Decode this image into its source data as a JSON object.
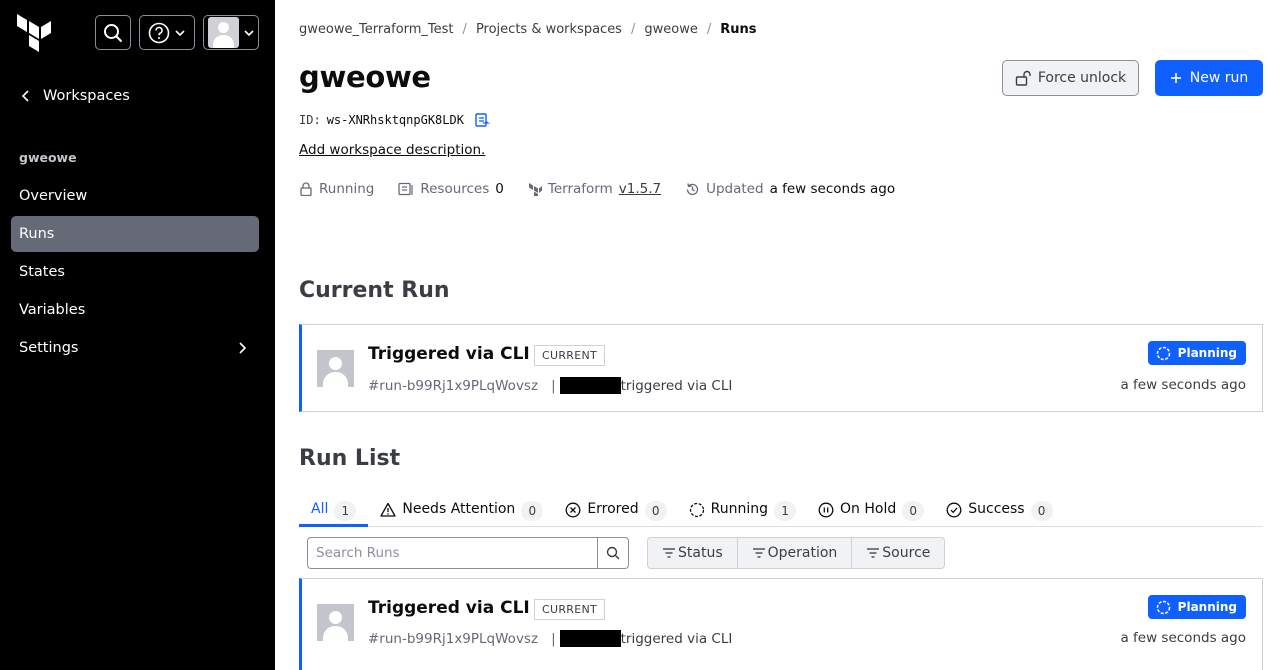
{
  "sidebar": {
    "back_label": "Workspaces",
    "workspace_name": "gweowe",
    "items": [
      {
        "label": "Overview"
      },
      {
        "label": "Runs"
      },
      {
        "label": "States"
      },
      {
        "label": "Variables"
      },
      {
        "label": "Settings"
      }
    ],
    "active_item": "Runs"
  },
  "breadcrumb": [
    "gweowe_Terraform_Test",
    "Projects & workspaces",
    "gweowe",
    "Runs"
  ],
  "header": {
    "title": "gweowe",
    "id_label": "ID:",
    "id_value": "ws-XNRhsktqnpGK8LDK",
    "add_description": "Add workspace description.",
    "force_unlock": "Force unlock",
    "new_run": "New run"
  },
  "meta": {
    "status": "Running",
    "resources_label": "Resources",
    "resources_count": "0",
    "terraform_label": "Terraform",
    "terraform_version": "v1.5.7",
    "updated_label": "Updated",
    "updated_value": "a few seconds ago"
  },
  "current_run": {
    "heading": "Current Run",
    "title": "Triggered via CLI",
    "tag": "CURRENT",
    "run_id": "#run-b99Rj1x9PLqWovsz",
    "pipe": "|",
    "trigger_text": "triggered via CLI",
    "status": "Planning",
    "time": "a few seconds ago"
  },
  "run_list": {
    "heading": "Run List",
    "tabs": [
      {
        "label": "All",
        "count": "1"
      },
      {
        "label": "Needs Attention",
        "count": "0"
      },
      {
        "label": "Errored",
        "count": "0"
      },
      {
        "label": "Running",
        "count": "1"
      },
      {
        "label": "On Hold",
        "count": "0"
      },
      {
        "label": "Success",
        "count": "0"
      }
    ],
    "search_placeholder": "Search Runs",
    "filters": [
      "Status",
      "Operation",
      "Source"
    ],
    "runs": [
      {
        "title": "Triggered via CLI",
        "tag": "CURRENT",
        "run_id": "#run-b99Rj1x9PLqWovsz",
        "pipe": "|",
        "trigger_text": "triggered via CLI",
        "status": "Planning",
        "time": "a few seconds ago"
      }
    ]
  },
  "colors": {
    "accent": "#1060ff",
    "sidebar_bg": "#000000",
    "nav_active": "#656a76"
  }
}
